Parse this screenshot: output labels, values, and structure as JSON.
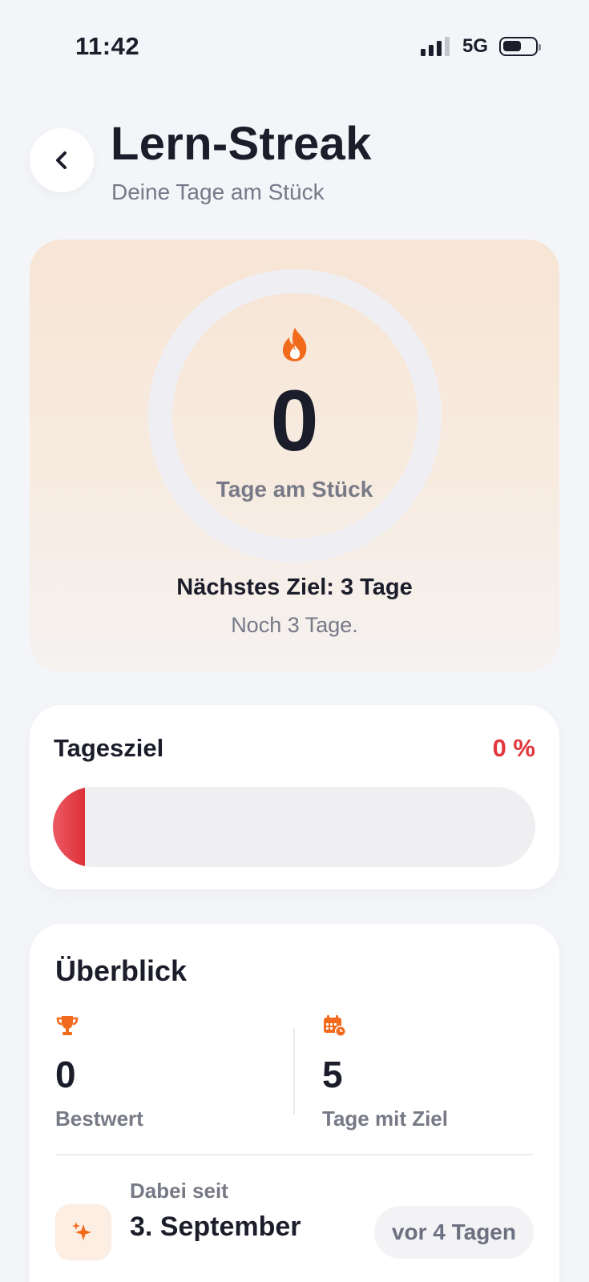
{
  "status_bar": {
    "time": "11:42",
    "network": "5G",
    "signal_bars": 3,
    "battery_level": 0.5
  },
  "header": {
    "back_icon": "chevron-left-icon",
    "title": "Lern-Streak",
    "subtitle": "Deine Tage am Stück"
  },
  "streak": {
    "icon": "flame-icon",
    "count": "0",
    "label": "Tage am Stück",
    "next_goal": "Nächstes Ziel: 3 Tage",
    "remaining": "Noch 3 Tage."
  },
  "daily_goal": {
    "title": "Tagesziel",
    "percent_label": "0 %",
    "progress_percent": 0,
    "accent_color": "#e0363e"
  },
  "overview": {
    "title": "Überblick",
    "best": {
      "icon": "trophy-icon",
      "value": "0",
      "label": "Bestwert"
    },
    "goal_days": {
      "icon": "calendar-icon",
      "value": "5",
      "label": "Tage mit Ziel"
    },
    "since": {
      "icon": "sparkles-icon",
      "label": "Dabei seit",
      "date": "3. September",
      "relative": "vor 4 Tagen"
    }
  },
  "colors": {
    "accent_orange": "#f26b1d",
    "danger_red": "#e0363e",
    "background": "#f4f5f9"
  }
}
